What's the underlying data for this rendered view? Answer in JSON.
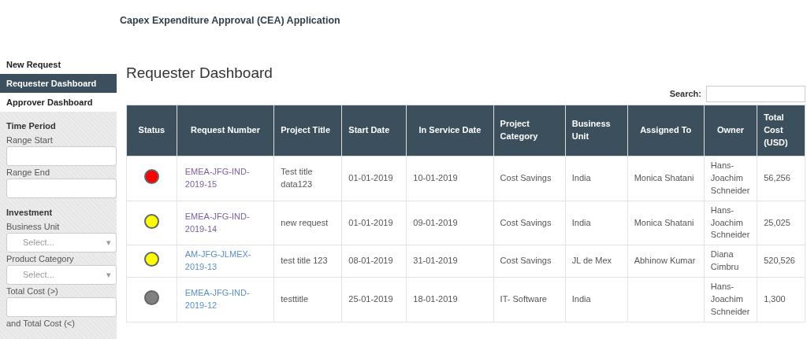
{
  "app_title": "Capex Expenditure Approval (CEA) Application",
  "sidebar": {
    "nav": [
      {
        "label": "New Request",
        "selected": false
      },
      {
        "label": "Requester Dashboard",
        "selected": true
      },
      {
        "label": "Approver Dashboard",
        "selected": false
      }
    ],
    "sections": [
      {
        "heading": "Time Period",
        "fields": [
          {
            "kind": "text",
            "label": "Range Start"
          },
          {
            "kind": "text",
            "label": "Range End"
          }
        ]
      },
      {
        "heading": "Investment",
        "fields": [
          {
            "kind": "select",
            "label": "Business Unit",
            "placeholder": "Select...",
            "caret": "▾"
          },
          {
            "kind": "select",
            "label": "Product Category",
            "placeholder": "Select...",
            "caret": "▾"
          },
          {
            "kind": "text",
            "label": "Total Cost (>)"
          },
          {
            "kind": "label",
            "label": "and Total Cost (<)"
          }
        ]
      }
    ]
  },
  "page_title": "Requester Dashboard",
  "search": {
    "label": "Search:"
  },
  "table": {
    "columns": [
      "Status",
      "Request Number",
      "Project Title",
      "Start Date",
      "In Service Date",
      "Project Category",
      "Business Unit",
      "Assigned To",
      "Owner",
      "Total Cost (USD)"
    ],
    "rows": [
      {
        "color": "#ff0000",
        "request_number": "EMEA-JFG-IND-2019-15",
        "visited": true,
        "project_title": "Test title data123",
        "start_date": "01-01-2019",
        "in_service_date": "10-01-2019",
        "project_category": "Cost Savings",
        "business_unit": "India",
        "assigned_to": "Monica Shatani",
        "owner": "Hans-Joachim Schneider",
        "total_cost": "56,256"
      },
      {
        "color": "#ffff00",
        "request_number": "EMEA-JFG-IND-2019-14",
        "visited": true,
        "project_title": "new request",
        "start_date": "01-01-2019",
        "in_service_date": "09-01-2019",
        "project_category": "Cost Savings",
        "business_unit": "India",
        "assigned_to": "Monica Shatani",
        "owner": "Hans-Joachim Schneider",
        "total_cost": "25,025"
      },
      {
        "color": "#ffff00",
        "request_number": "AM-JFG-JLMEX-2019-13",
        "visited": false,
        "project_title": "test title 123",
        "start_date": "08-01-2019",
        "in_service_date": "31-01-2019",
        "project_category": "Cost Savings",
        "business_unit": "JL de Mex",
        "assigned_to": "Abhinow Kumar",
        "owner": "Diana Cimbru",
        "total_cost": "520,526"
      },
      {
        "color": "#808080",
        "request_number": "EMEA-JFG-IND-2019-12",
        "visited": false,
        "project_title": "testtitle",
        "start_date": "25-01-2019",
        "in_service_date": "18-01-2019",
        "project_category": "IT- Software",
        "business_unit": "India",
        "owner": "Hans-Joachim Schneider",
        "total_cost": "1,300"
      }
    ]
  }
}
